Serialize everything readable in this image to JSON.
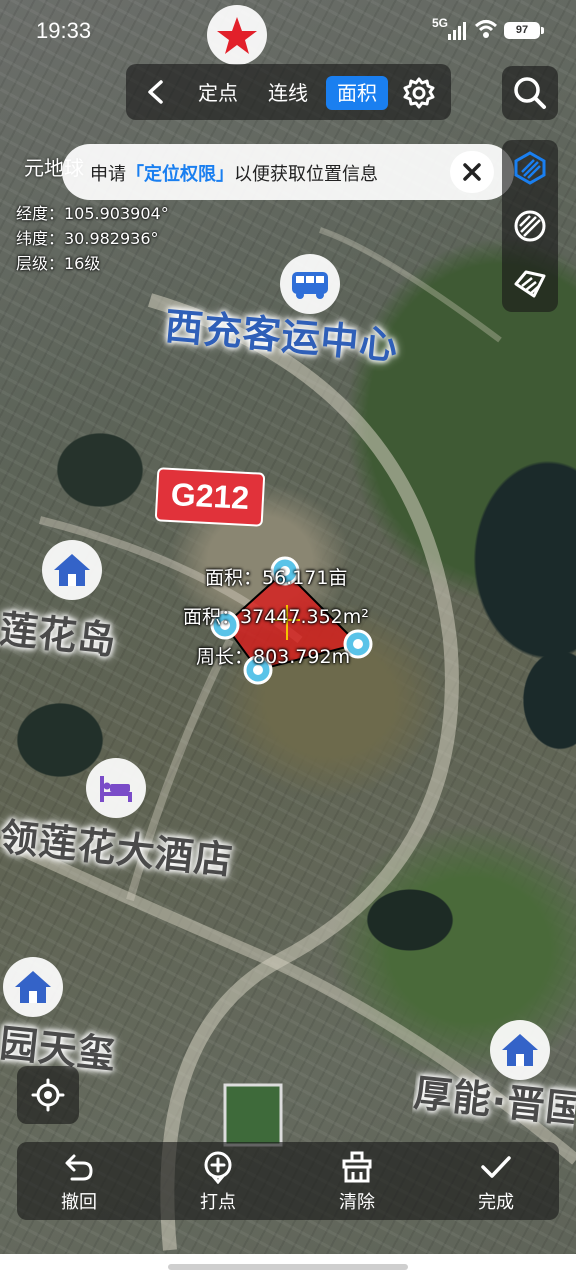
{
  "status_bar": {
    "time": "19:33",
    "network": "5G",
    "battery": "97"
  },
  "toolbar": {
    "tab_point": "定点",
    "tab_line": "连线",
    "tab_area": "面积",
    "active_tab": "面积"
  },
  "app_name": "元地球",
  "coords": {
    "lon": "经度：105.903904°",
    "lat": "纬度：30.982936°",
    "level": "层级：16级"
  },
  "banner": {
    "prefix": "申请",
    "highlight": "「定位权限」",
    "suffix": "以便获取位置信息"
  },
  "pois": {
    "bus_station": "西充客运中心",
    "road": "G212",
    "lianhua": "莲花岛",
    "hotel": "领莲花大酒店",
    "yuantianxi": "园天玺",
    "houneng": "厚能·晋国"
  },
  "measurement": {
    "area_mu": "面积：56.171亩",
    "area_m2": "面积：37447.352m²",
    "perimeter": "周长：803.792m"
  },
  "bottom_bar": {
    "undo": "撤回",
    "add_point": "打点",
    "clear": "清除",
    "done": "完成"
  },
  "colors": {
    "accent": "#1a7ff0",
    "polygon_fill": "#e02020",
    "road_badge": "#e1323a"
  },
  "icons": {
    "back": "chevron-left-icon",
    "settings": "gear-icon",
    "search": "search-icon",
    "layer_satellite": "satellite-layer-icon",
    "layer_hatch": "hatch-layer-icon",
    "layer_terrain": "terrain-layer-icon",
    "bus": "bus-icon",
    "home": "house-icon",
    "hotel": "bed-icon",
    "locate": "locate-icon",
    "undo": "undo-icon",
    "add_point": "add-point-icon",
    "clear": "broom-icon",
    "done": "check-icon"
  }
}
